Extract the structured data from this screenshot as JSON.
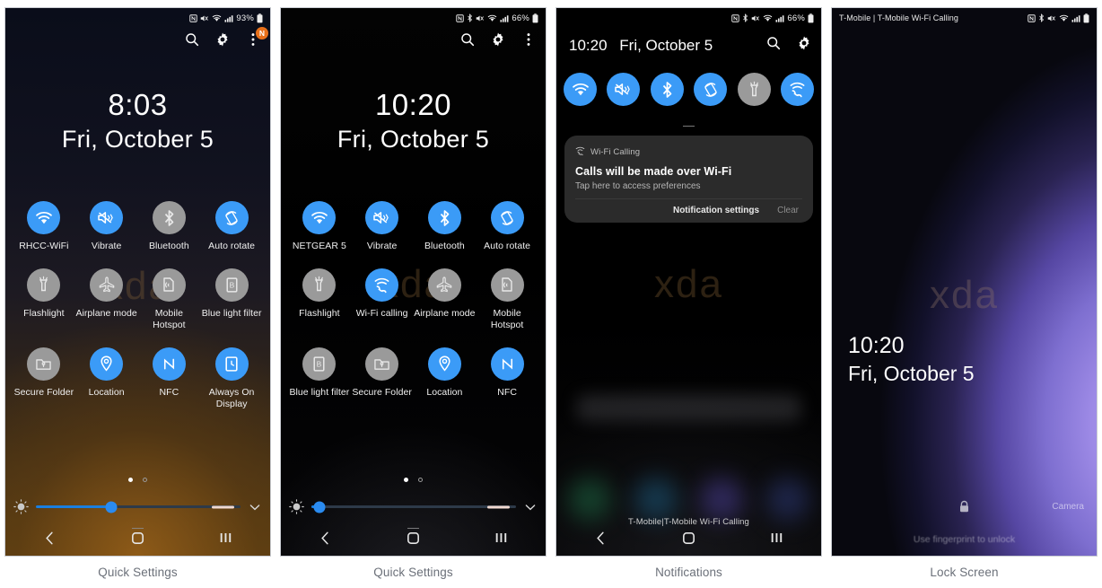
{
  "panels": [
    {
      "caption": "Quick Settings",
      "status_bar": {
        "left_text": "",
        "icons": [
          "nfc-icon",
          "mute-icon",
          "wifi-icon",
          "signal-icon"
        ],
        "battery": "93%"
      },
      "header_actions": [
        {
          "name": "search-icon",
          "label": "Search"
        },
        {
          "name": "gear-icon",
          "label": "Settings"
        },
        {
          "name": "overflow-menu-icon",
          "label": "More options",
          "badge": "N"
        }
      ],
      "clock": {
        "time": "8:03",
        "date": "Fri, October 5"
      },
      "watermark": "xda",
      "tiles": [
        {
          "label": "RHCC-WiFi",
          "icon": "wifi-icon",
          "state": "on"
        },
        {
          "label": "Vibrate",
          "icon": "vibrate-icon",
          "state": "on"
        },
        {
          "label": "Bluetooth",
          "icon": "bluetooth-icon",
          "state": "off"
        },
        {
          "label": "Auto rotate",
          "icon": "auto-rotate-icon",
          "state": "on"
        },
        {
          "label": "Flashlight",
          "icon": "flashlight-icon",
          "state": "off"
        },
        {
          "label": "Airplane mode",
          "icon": "airplane-icon",
          "state": "off"
        },
        {
          "label": "Mobile Hotspot",
          "icon": "hotspot-icon",
          "state": "off"
        },
        {
          "label": "Blue light filter",
          "icon": "blue-light-icon",
          "state": "off"
        },
        {
          "label": "Secure Folder",
          "icon": "secure-folder-icon",
          "state": "off"
        },
        {
          "label": "Location",
          "icon": "location-icon",
          "state": "on"
        },
        {
          "label": "NFC",
          "icon": "nfc-icon",
          "state": "on"
        },
        {
          "label": "Always On Display",
          "icon": "always-on-display-icon",
          "state": "on"
        }
      ],
      "brightness": {
        "value_pct": 37,
        "auto_pct": 88,
        "page": 1,
        "pages": 2
      },
      "nav": [
        "back-button",
        "home-button",
        "recents-button"
      ]
    },
    {
      "caption": "Quick Settings",
      "status_bar": {
        "left_text": "",
        "icons": [
          "nfc-icon",
          "bluetooth-icon",
          "mute-icon",
          "wifi-icon",
          "signal-icon"
        ],
        "battery": "66%"
      },
      "header_actions": [
        {
          "name": "search-icon",
          "label": "Search"
        },
        {
          "name": "gear-icon",
          "label": "Settings"
        },
        {
          "name": "overflow-menu-icon",
          "label": "More options",
          "badge": ""
        }
      ],
      "clock": {
        "time": "10:20",
        "date": "Fri, October 5"
      },
      "watermark": "xda",
      "tiles": [
        {
          "label": "NETGEAR 5",
          "icon": "wifi-icon",
          "state": "on"
        },
        {
          "label": "Vibrate",
          "icon": "vibrate-icon",
          "state": "on"
        },
        {
          "label": "Bluetooth",
          "icon": "bluetooth-icon",
          "state": "on"
        },
        {
          "label": "Auto rotate",
          "icon": "auto-rotate-icon",
          "state": "on"
        },
        {
          "label": "Flashlight",
          "icon": "flashlight-icon",
          "state": "off"
        },
        {
          "label": "Wi-Fi calling",
          "icon": "wifi-calling-icon",
          "state": "on"
        },
        {
          "label": "Airplane mode",
          "icon": "airplane-icon",
          "state": "off"
        },
        {
          "label": "Mobile Hotspot",
          "icon": "hotspot-icon",
          "state": "off"
        },
        {
          "label": "Blue light filter",
          "icon": "blue-light-icon",
          "state": "off"
        },
        {
          "label": "Secure Folder",
          "icon": "secure-folder-icon",
          "state": "off"
        },
        {
          "label": "Location",
          "icon": "location-icon",
          "state": "on"
        },
        {
          "label": "NFC",
          "icon": "nfc-icon",
          "state": "on"
        }
      ],
      "brightness": {
        "value_pct": 4,
        "auto_pct": 88,
        "page": 1,
        "pages": 2
      },
      "nav": [
        "back-button",
        "home-button",
        "recents-button"
      ]
    },
    {
      "caption": "Notifications",
      "status_bar": {
        "left_text": "",
        "icons": [
          "nfc-icon",
          "bluetooth-icon",
          "mute-icon",
          "wifi-icon",
          "signal-icon"
        ],
        "battery": "66%"
      },
      "header_actions": [
        {
          "name": "search-icon",
          "label": "Search"
        },
        {
          "name": "gear-icon",
          "label": "Settings"
        }
      ],
      "clock_inline": {
        "time": "10:20",
        "date": "Fri, October 5"
      },
      "quick_toggles": [
        {
          "label": "Wi-Fi",
          "icon": "wifi-icon",
          "state": "on"
        },
        {
          "label": "Vibrate",
          "icon": "vibrate-icon",
          "state": "on"
        },
        {
          "label": "Bluetooth",
          "icon": "bluetooth-icon",
          "state": "on"
        },
        {
          "label": "Auto rotate",
          "icon": "auto-rotate-icon",
          "state": "on"
        },
        {
          "label": "Flashlight",
          "icon": "flashlight-icon",
          "state": "off"
        },
        {
          "label": "Wi-Fi calling",
          "icon": "wifi-calling-icon",
          "state": "on"
        }
      ],
      "notification": {
        "app_icon": "wifi-calling-icon",
        "app_name": "Wi-Fi Calling",
        "title": "Calls will be made over Wi-Fi",
        "subtitle": "Tap here to access preferences",
        "action_primary": "Notification settings",
        "action_secondary": "Clear"
      },
      "watermark": "xda",
      "carrier": "T-Mobile|T-Mobile Wi-Fi Calling",
      "nav": [
        "back-button",
        "home-button",
        "recents-button"
      ]
    },
    {
      "caption": "Lock Screen",
      "status_bar": {
        "left_text": "T-Mobile | T-Mobile Wi-Fi Calling",
        "icons": [
          "nfc-icon",
          "bluetooth-icon",
          "mute-icon",
          "wifi-icon",
          "signal-icon"
        ],
        "battery": ""
      },
      "watermark": "xda",
      "clock": {
        "time": "10:20",
        "date": "Fri, October 5"
      },
      "lock_icon": "lock-icon",
      "hint": "Use fingerprint to unlock",
      "camera_label": "Camera"
    }
  ],
  "colors": {
    "accent_on": "#3b9bf7",
    "tile_off": "#9a9a9a",
    "badge": "#e8701a",
    "slider_fill": "#1a7fe0",
    "caption": "#6b7079"
  }
}
